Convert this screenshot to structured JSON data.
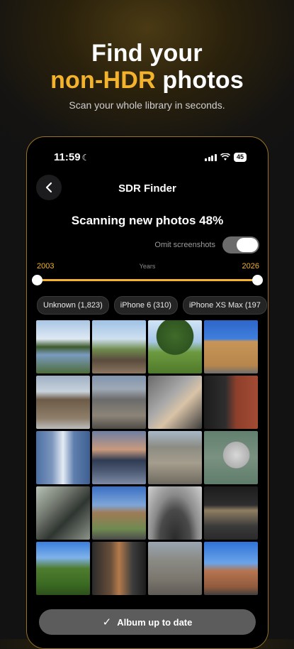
{
  "hero": {
    "title_line1": "Find your",
    "title_accent": "non-HDR",
    "title_rest": "photos",
    "subtitle": "Scan your whole library in seconds."
  },
  "status_bar": {
    "time": "11:59",
    "battery": "45"
  },
  "nav": {
    "title": "SDR Finder"
  },
  "scan": {
    "status": "Scanning new photos 48%",
    "progress": 0.48
  },
  "omit_screenshots": {
    "label": "Omit screenshots",
    "on": true
  },
  "years": {
    "start": "2003",
    "label": "Years",
    "end": "2026"
  },
  "filters": [
    {
      "label": "Unknown (1,823)"
    },
    {
      "label": "iPhone 6 (310)"
    },
    {
      "label": "iPhone XS Max (197"
    }
  ],
  "photos": [
    {
      "icon": "lake-photo"
    },
    {
      "icon": "people-photo"
    },
    {
      "icon": "park-photo"
    },
    {
      "icon": "church-photo"
    },
    {
      "icon": "street-photo"
    },
    {
      "icon": "station-photo"
    },
    {
      "icon": "hands-photo"
    },
    {
      "icon": "brick-photo"
    },
    {
      "icon": "tower-photo"
    },
    {
      "icon": "skyline-photo"
    },
    {
      "icon": "aerial-photo"
    },
    {
      "icon": "stadium-photo"
    },
    {
      "icon": "aerial-photo"
    },
    {
      "icon": "tall-building-photo"
    },
    {
      "icon": "arch-photo"
    },
    {
      "icon": "building-photo"
    },
    {
      "icon": "trees-photo"
    },
    {
      "icon": "downtown-photo"
    },
    {
      "icon": "aerial-city-photo"
    },
    {
      "icon": "blue-tower-photo"
    }
  ],
  "cta": {
    "label": "Album up to date"
  },
  "colors": {
    "accent": "#f3b32c",
    "frame": "#9a7426",
    "chip_bg": "#242424",
    "cta_bg": "#5c5c5c"
  }
}
